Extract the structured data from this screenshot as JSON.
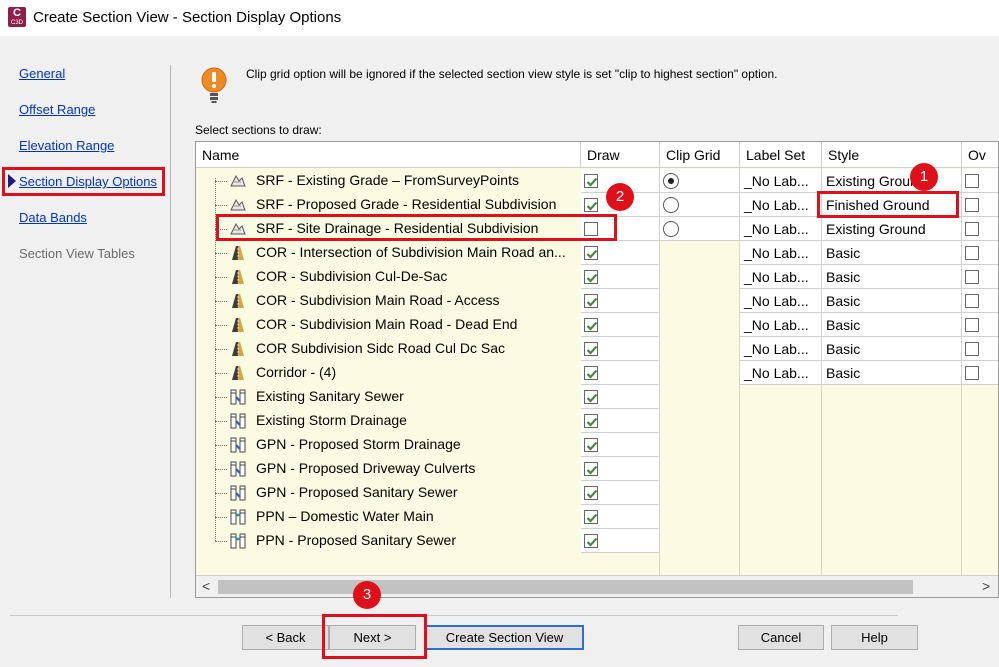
{
  "window": {
    "title": "Create Section View - Section Display Options",
    "app_icon_letter": "C",
    "app_icon_sub": "C3D"
  },
  "nav": {
    "items": [
      {
        "label": "General",
        "active": false,
        "disabled": false
      },
      {
        "label": "Offset Range",
        "active": false,
        "disabled": false
      },
      {
        "label": "Elevation Range",
        "active": false,
        "disabled": false
      },
      {
        "label": "Section Display Options",
        "active": true,
        "disabled": false
      },
      {
        "label": "Data Bands",
        "active": false,
        "disabled": false
      },
      {
        "label": "Section View Tables",
        "active": false,
        "disabled": true
      }
    ]
  },
  "notice": {
    "icon": "warning-bulb-icon",
    "text": "Clip grid option will be ignored if the selected section view style is set \"clip to highest section\" option."
  },
  "grid": {
    "label": "Select sections to draw:",
    "columns": [
      "Name",
      "Draw",
      "Clip Grid",
      "Label Set",
      "Style",
      "Ov"
    ],
    "rows": [
      {
        "icon": "surface-icon",
        "name": "SRF - Existing Grade – FromSurveyPoints",
        "draw": true,
        "clip_grid": true,
        "label_set": "_No Lab...",
        "style": "Existing Ground",
        "override": false
      },
      {
        "icon": "surface-icon",
        "name": "SRF - Proposed Grade - Residential Subdivision",
        "draw": true,
        "clip_grid": false,
        "label_set": "_No Lab...",
        "style": "Finished Ground",
        "override": false
      },
      {
        "icon": "surface-icon",
        "name": "SRF - Site Drainage - Residential Subdivision",
        "draw": false,
        "clip_grid": false,
        "label_set": "_No Lab...",
        "style": "Existing Ground",
        "override": false
      },
      {
        "icon": "corridor-icon",
        "name": "COR - Intersection of Subdivision Main Road an...",
        "draw": true,
        "label_set": "_No Lab...",
        "style": "Basic",
        "override": false
      },
      {
        "icon": "corridor-icon",
        "name": "COR - Subdivision Cul-De-Sac",
        "draw": true,
        "label_set": "_No Lab...",
        "style": "Basic",
        "override": false
      },
      {
        "icon": "corridor-icon",
        "name": "COR - Subdivision Main Road - Access",
        "draw": true,
        "label_set": "_No Lab...",
        "style": "Basic",
        "override": false
      },
      {
        "icon": "corridor-icon",
        "name": "COR - Subdivision Main Road - Dead End",
        "draw": true,
        "label_set": "_No Lab...",
        "style": "Basic",
        "override": false
      },
      {
        "icon": "corridor-icon",
        "name": "COR   Subdivision Sidc Road   Cul Dc Sac",
        "draw": true,
        "label_set": "_No Lab...",
        "style": "Basic",
        "override": false
      },
      {
        "icon": "corridor-icon",
        "name": "Corridor - (4)",
        "draw": true,
        "label_set": "_No Lab...",
        "style": "Basic",
        "override": false
      },
      {
        "icon": "pipe-network-icon",
        "name": "Existing Sanitary Sewer",
        "draw": true
      },
      {
        "icon": "pipe-network-icon",
        "name": "Existing Storm Drainage",
        "draw": true
      },
      {
        "icon": "pipe-network-icon",
        "name": "GPN - Proposed Storm Drainage",
        "draw": true
      },
      {
        "icon": "pipe-network-icon",
        "name": "GPN - Proposed Driveway Culverts",
        "draw": true
      },
      {
        "icon": "pipe-network-icon",
        "name": "GPN - Proposed Sanitary Sewer",
        "draw": true
      },
      {
        "icon": "pressure-network-icon",
        "name": "PPN – Domestic Water Main",
        "draw": true
      },
      {
        "icon": "pressure-network-icon",
        "name": "PPN - Proposed Sanitary Sewer",
        "draw": true
      }
    ]
  },
  "scrollbar": {
    "left_arrow": "<",
    "right_arrow": ">"
  },
  "buttons": {
    "back": "< Back",
    "next": "Next >",
    "create": "Create Section View",
    "cancel": "Cancel",
    "help": "Help"
  },
  "callouts": [
    "1",
    "2",
    "3"
  ],
  "colors": {
    "highlight": "#e0101a",
    "link": "#0033cc",
    "row_bg": "#fbfbe3",
    "check": "#2f8a2f"
  }
}
